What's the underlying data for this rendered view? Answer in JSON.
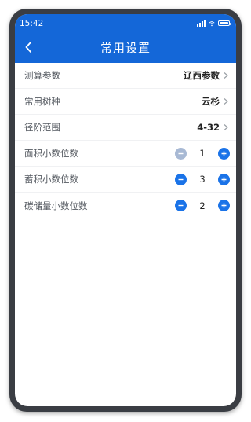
{
  "status": {
    "time": "15:42"
  },
  "nav": {
    "title": "常用设置"
  },
  "settings": [
    {
      "label": "测算参数",
      "value": "辽西参数"
    },
    {
      "label": "常用树种",
      "value": "云杉"
    },
    {
      "label": "径阶范围",
      "value": "4-32"
    }
  ],
  "steppers": [
    {
      "label": "面积小数位数",
      "value": "1",
      "minus_enabled": false
    },
    {
      "label": "蓄积小数位数",
      "value": "3",
      "minus_enabled": true
    },
    {
      "label": "碳储量小数位数",
      "value": "2",
      "minus_enabled": true
    }
  ],
  "colors": {
    "primary": "#1467d8",
    "button": "#1a73e8",
    "button_disabled": "#a8b9d4"
  },
  "icons": {
    "back": "chevron-left-icon",
    "row_arrow": "chevron-right-icon",
    "minus": "minus-circle-icon",
    "plus": "plus-circle-icon"
  }
}
